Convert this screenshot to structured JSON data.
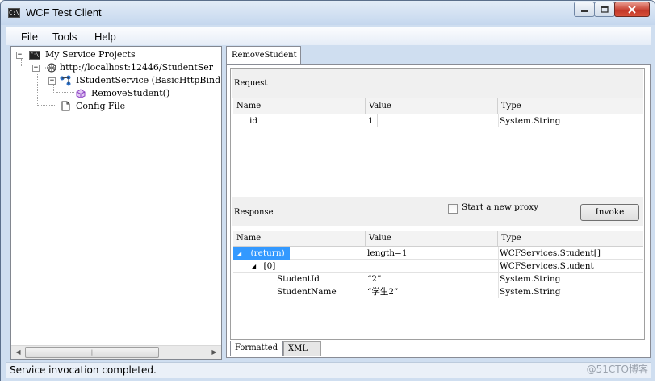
{
  "window": {
    "title": "WCF Test Client"
  },
  "menu": {
    "file": "File",
    "tools": "Tools",
    "help": "Help"
  },
  "tree": {
    "root": "My Service Projects",
    "endpoint": "http://localhost:12446/StudentSer",
    "service": "IStudentService (BasicHttpBind",
    "operation": "RemoveStudent()",
    "config": "Config File"
  },
  "tab": {
    "label": "RemoveStudent"
  },
  "request": {
    "title": "Request",
    "columns": [
      "Name",
      "Value",
      "Type"
    ],
    "rows": [
      {
        "name": "id",
        "value": "1",
        "type": "System.String"
      }
    ]
  },
  "response": {
    "title": "Response",
    "start_proxy_label": "Start a new proxy",
    "invoke_label": "Invoke",
    "columns": [
      "Name",
      "Value",
      "Type"
    ],
    "rows": [
      {
        "name": "(return)",
        "value": "length=1",
        "type": "WCFServices.Student[]"
      },
      {
        "name": "[0]",
        "value": "",
        "type": "WCFServices.Student"
      },
      {
        "name": "StudentId",
        "value": "“2”",
        "type": "System.String"
      },
      {
        "name": "StudentName",
        "value": "“学生2”",
        "type": "System.String"
      }
    ]
  },
  "bottom_tabs": {
    "formatted": "Formatted",
    "xml": "XML"
  },
  "status": {
    "text": "Service invocation completed."
  },
  "watermark": "@51CTO博客"
}
